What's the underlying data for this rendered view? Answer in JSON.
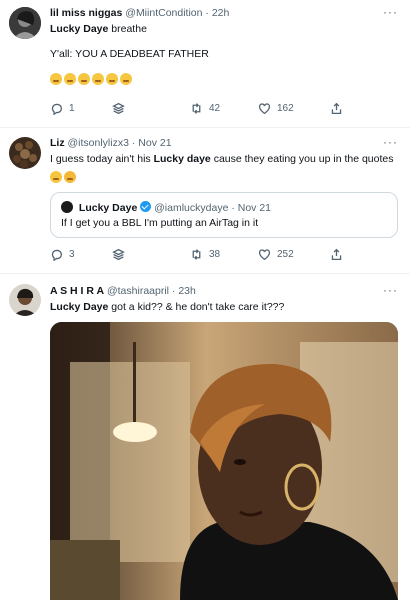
{
  "tweets": [
    {
      "name": "lil miss niggas",
      "handle": "@MiintCondition",
      "time": "· 22h",
      "more": "···",
      "line1_bold": "Lucky Daye",
      "line1_rest": " breathe",
      "line2": "Y'all: YOU A DEADBEAT FATHER",
      "emojis": [
        "grimace-emoji",
        "grimace-emoji",
        "grimace-emoji",
        "laugh-emoji",
        "laugh-emoji",
        "laugh-emoji"
      ],
      "replies": "1",
      "retweets": "42",
      "likes": "162"
    },
    {
      "name": "Liz",
      "handle": "@itsonlylizx3",
      "time": "· Nov 21",
      "more": "···",
      "text_pre": "I guess today ain't his ",
      "text_bold": "Lucky daye",
      "text_post": " cause they eating you up in the quotes",
      "quote": {
        "name": "Lucky Daye",
        "handle": "@iamluckydaye",
        "time": "· Nov 21",
        "text": "If I get you a BBL I'm putting an AirTag in it"
      },
      "replies": "3",
      "retweets": "38",
      "likes": "252"
    },
    {
      "name": "A S H I R A",
      "handle": "@tashiraapril",
      "time": "· 23h",
      "more": "···",
      "text_bold": "Lucky Daye",
      "text_post": " got a kid?? & he don't take care it???"
    }
  ],
  "colors": {
    "muted": "#536471",
    "border": "#eff3f4",
    "verified": "#1d9bf0"
  }
}
